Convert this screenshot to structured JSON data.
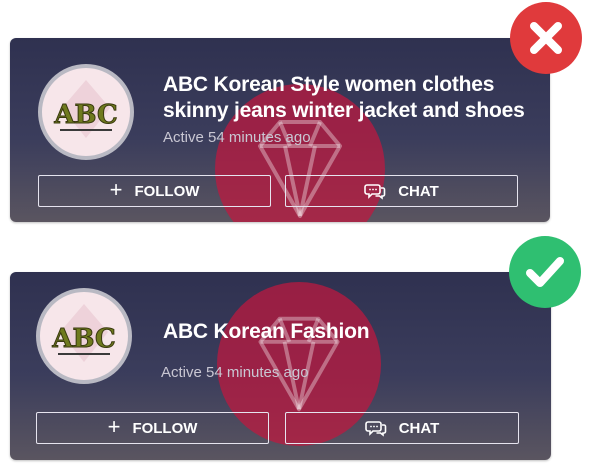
{
  "colors": {
    "card_background": "#35375a",
    "wrong_badge": "#e03a3c",
    "correct_badge": "#2fbf71",
    "watermark": "#c0183e"
  },
  "avatar": {
    "logo_text": "ABC"
  },
  "examples": [
    {
      "verdict": "wrong",
      "badge_icon": "x-mark-icon",
      "shop_name_line1": "ABC Korean Style women clothes",
      "shop_name_line2": "skinny jeans winter jacket and shoes",
      "active_status": "Active 54 minutes ago",
      "follow_label": "FOLLOW",
      "chat_label": "CHAT"
    },
    {
      "verdict": "correct",
      "badge_icon": "check-mark-icon",
      "shop_name_line1": "ABC Korean Fashion",
      "active_status": "Active 54 minutes ago",
      "follow_label": "FOLLOW",
      "chat_label": "CHAT"
    }
  ]
}
